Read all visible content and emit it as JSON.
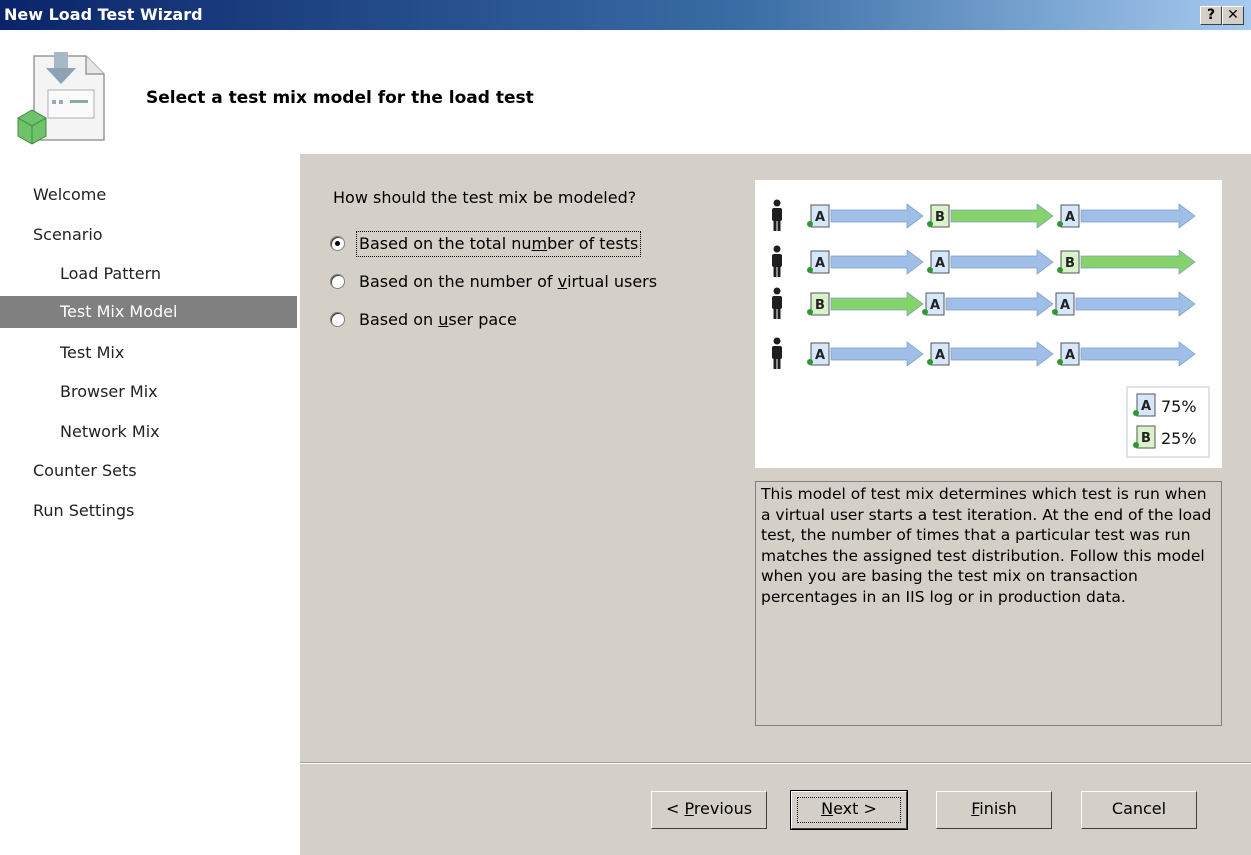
{
  "window": {
    "title": "New Load Test Wizard",
    "help_label": "?",
    "close_label": "✕"
  },
  "header": {
    "heading": "Select a test mix model for the load test",
    "icon": "wizard-document-icon"
  },
  "sidebar": {
    "items": [
      {
        "label": "Welcome",
        "sub": false,
        "selected": false
      },
      {
        "label": "Scenario",
        "sub": false,
        "selected": false
      },
      {
        "label": "Load Pattern",
        "sub": true,
        "selected": false
      },
      {
        "label": "Test Mix Model",
        "sub": true,
        "selected": true
      },
      {
        "label": "Test Mix",
        "sub": true,
        "selected": false
      },
      {
        "label": "Browser Mix",
        "sub": true,
        "selected": false
      },
      {
        "label": "Network Mix",
        "sub": true,
        "selected": false
      },
      {
        "label": "Counter Sets",
        "sub": false,
        "selected": false
      },
      {
        "label": "Run Settings",
        "sub": false,
        "selected": false
      }
    ]
  },
  "content": {
    "question": "How should the test mix be modeled?",
    "options": [
      {
        "pre": "Based on the total nu",
        "mn": "m",
        "post": "ber of tests",
        "checked": true
      },
      {
        "pre": "Based on the number of ",
        "mn": "v",
        "post": "irtual users",
        "checked": false
      },
      {
        "pre": "Based on ",
        "mn": "u",
        "post": "ser pace",
        "checked": false
      }
    ],
    "diagram": {
      "rows": [
        [
          "A",
          "B",
          "A"
        ],
        [
          "A",
          "A",
          "B"
        ],
        [
          "B",
          "A",
          "A"
        ],
        [
          "A",
          "A",
          "A"
        ]
      ],
      "legend": [
        {
          "letter": "A",
          "pct": "75%"
        },
        {
          "letter": "B",
          "pct": "25%"
        }
      ],
      "colors": {
        "A_arrow": "#9fbfe8",
        "B_arrow": "#86d36c",
        "person": "#1e1e1e"
      }
    },
    "description": "This model of test mix determines which test is run when a virtual user starts a test iteration. At the end of the load test, the number of times that a particular test was run matches the assigned test distribution. Follow this model when you are basing the test mix on transaction percentages in an IIS log or in production data."
  },
  "buttons": {
    "previous": {
      "pre": "< ",
      "mn": "P",
      "post": "revious"
    },
    "next": {
      "pre": "",
      "mn": "N",
      "post": "ext >"
    },
    "finish": {
      "pre": "",
      "mn": "F",
      "post": "inish"
    },
    "cancel": {
      "label": "Cancel"
    }
  }
}
